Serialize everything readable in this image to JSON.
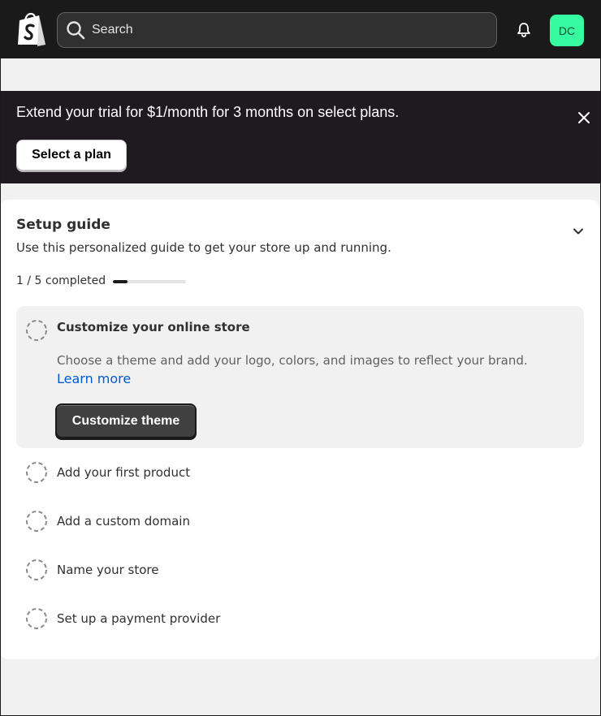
{
  "header": {
    "search_placeholder": "Search",
    "avatar_initials": "DC",
    "avatar_color": "#36fba1"
  },
  "banner": {
    "message": "Extend your trial for $1/month for 3 months on select plans.",
    "cta_label": "Select a plan"
  },
  "setup_guide": {
    "title": "Setup guide",
    "subtitle": "Use this personalized guide to get your store up and running.",
    "progress_text": "1 / 5 completed",
    "progress_fraction": 0.2,
    "active_task": {
      "label": "Customize your online store",
      "description": "Choose a theme and add your logo, colors, and images to reflect your brand.",
      "link_label": "Learn more",
      "button_label": "Customize theme"
    },
    "tasks": [
      {
        "label": "Add your first product"
      },
      {
        "label": "Add a custom domain"
      },
      {
        "label": "Name your store"
      },
      {
        "label": "Set up a payment provider"
      }
    ]
  }
}
